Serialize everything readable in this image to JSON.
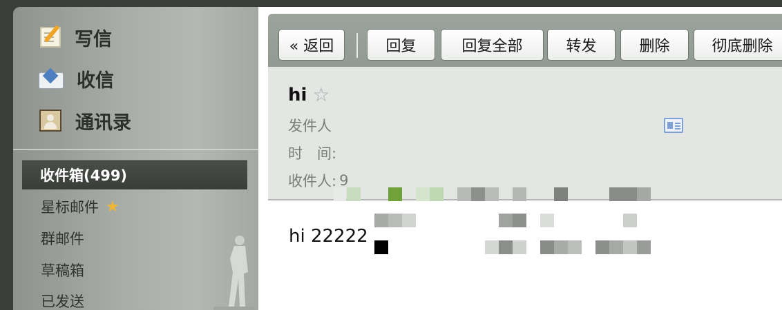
{
  "sidebar": {
    "compose_label": "写信",
    "inbox_label": "收信",
    "contacts_label": "通讯录",
    "folders": {
      "inbox": "收件箱(499)",
      "starred": "星标邮件",
      "group": "群邮件",
      "drafts": "草稿箱",
      "sent": "已发送"
    }
  },
  "toolbar": {
    "back": "« 返回",
    "reply": "回复",
    "reply_all": "回复全部",
    "forward": "转发",
    "delete": "删除",
    "delete_permanently": "彻底删除"
  },
  "message": {
    "subject": "hi",
    "from_label": "发件人",
    "time_label": "时　间:",
    "to_label": "收件人:",
    "to_partial": "9",
    "body": "hi 22222"
  },
  "colors": {
    "accent_star": "#f2b732",
    "selected_folder_bg": "#3f423e",
    "toolbar_bg": "#959e97",
    "header_bg": "#e4e6e4"
  }
}
